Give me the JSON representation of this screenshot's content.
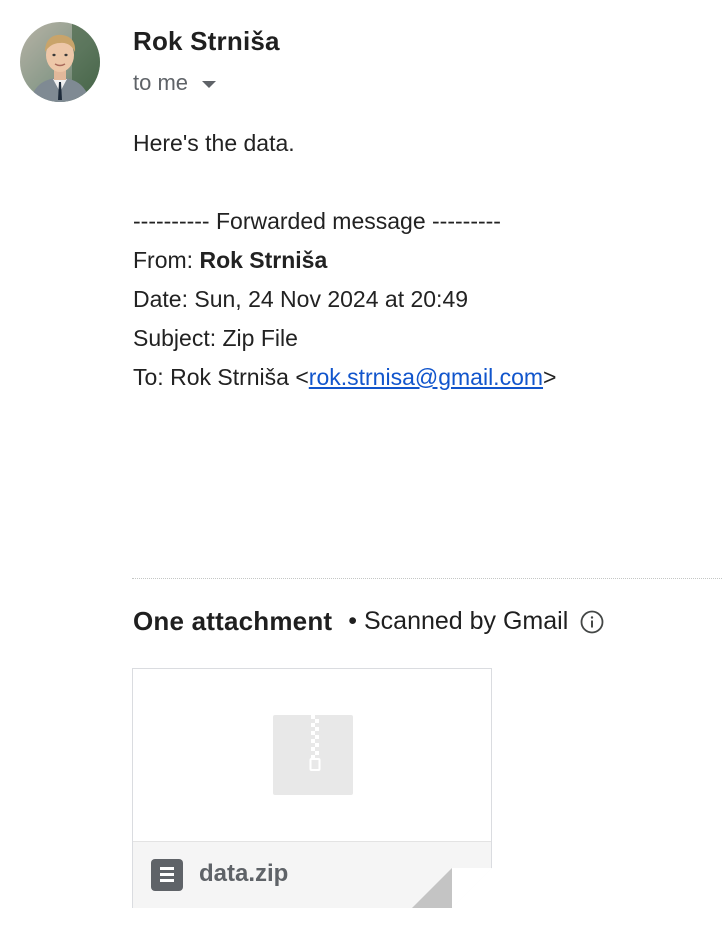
{
  "sender": {
    "name": "Rok Strniša",
    "recipient_label": "to me"
  },
  "message": {
    "greeting": "Here's the data.",
    "forward_header": "---------- Forwarded message ---------",
    "from_label": "From:",
    "from_name": "Rok Strniša",
    "date_label": "Date:",
    "date_value": "Sun, 24 Nov 2024 at 20:49",
    "subject_label": "Subject:",
    "subject_value": "Zip File",
    "to_label": "To:",
    "to_name": "Rok Strniša",
    "to_email": "rok.strnisa@gmail.com"
  },
  "attachments": {
    "title": "One attachment",
    "scanned_text": "• Scanned by Gmail",
    "files": [
      {
        "name": "data.zip",
        "icon": "archive-file-icon"
      }
    ]
  },
  "colors": {
    "link": "#1155cc",
    "muted": "#5f6368",
    "text": "#222222"
  }
}
